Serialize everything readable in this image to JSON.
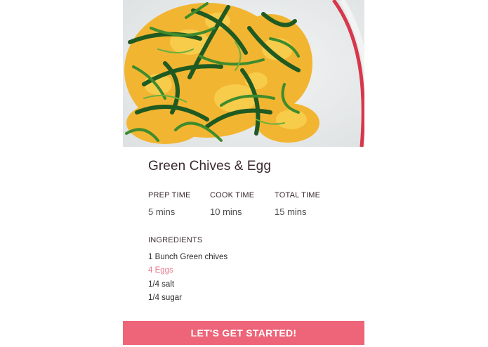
{
  "recipe": {
    "title": "Green Chives & Egg",
    "image_alt": "Scrambled eggs with green chives on a plate"
  },
  "times": [
    {
      "label": "PREP TIME",
      "value": "5 mins"
    },
    {
      "label": "COOK TIME",
      "value": "10 mins"
    },
    {
      "label": "TOTAL TIME",
      "value": "15 mins"
    }
  ],
  "ingredients": {
    "heading": "INGREDIENTS",
    "items": [
      {
        "text": "1 Bunch Green chives",
        "highlighted": false
      },
      {
        "text": "4 Eggs",
        "highlighted": true
      },
      {
        "text": "1/4 salt",
        "highlighted": false
      },
      {
        "text": "1/4 sugar",
        "highlighted": false
      }
    ]
  },
  "cta": {
    "label": "LET'S GET STARTED!"
  },
  "colors": {
    "accent": "#ee6478",
    "highlight_text": "#e7798a",
    "title_text": "#3b2a30"
  }
}
